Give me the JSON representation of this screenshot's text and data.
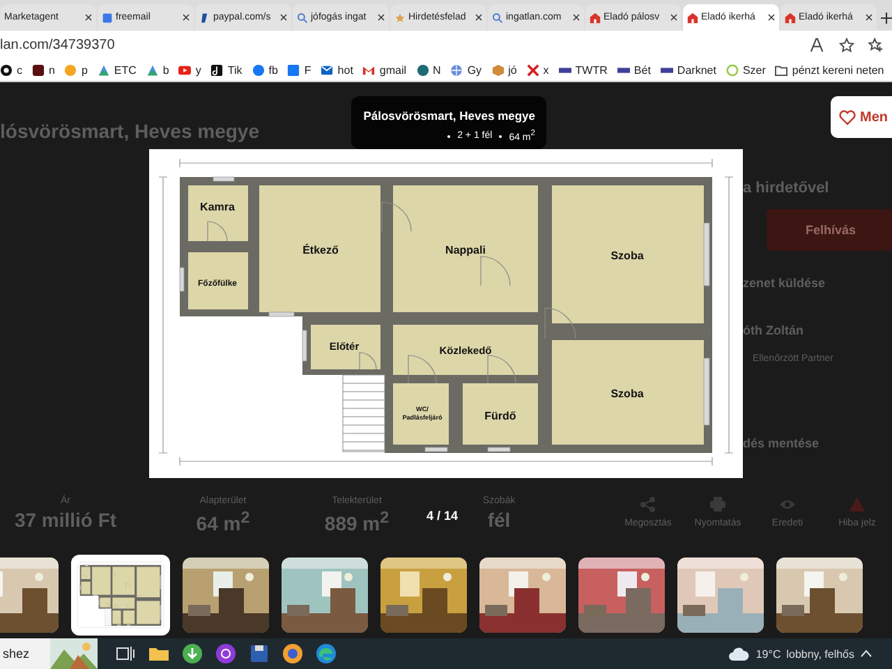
{
  "browser": {
    "tabs": [
      {
        "label": "Marketagent",
        "kind": "plain",
        "selected": false
      },
      {
        "label": "freemail",
        "kind": "square",
        "selected": false
      },
      {
        "label": "paypal.com/s",
        "kind": "slant",
        "selected": false
      },
      {
        "label": "jófogás ingat",
        "kind": "search",
        "selected": false
      },
      {
        "label": "Hirdetésfelad",
        "kind": "star",
        "selected": false
      },
      {
        "label": "ingatlan.com",
        "kind": "search",
        "selected": false
      },
      {
        "label": "Eladó pálosv",
        "kind": "house",
        "selected": false
      },
      {
        "label": "Eladó ikerhá",
        "kind": "house",
        "selected": true
      },
      {
        "label": "Eladó ikerhá",
        "kind": "house",
        "selected": false
      }
    ],
    "address": "lan.com/34739370",
    "bookmarks": [
      {
        "label": "c",
        "kind": "disc"
      },
      {
        "label": "n",
        "kind": "maroon"
      },
      {
        "label": "p",
        "kind": "orange"
      },
      {
        "label": "ETC",
        "kind": "chart"
      },
      {
        "label": "b",
        "kind": "chart"
      },
      {
        "label": "y",
        "kind": "play"
      },
      {
        "label": "Tik",
        "kind": "note"
      },
      {
        "label": "fb",
        "kind": "blue"
      },
      {
        "label": "F",
        "kind": "bluesq"
      },
      {
        "label": "hot",
        "kind": "mail"
      },
      {
        "label": "gmail",
        "kind": "gmail"
      },
      {
        "label": "N",
        "kind": "teal"
      },
      {
        "label": "Gy",
        "kind": "globe"
      },
      {
        "label": "jó",
        "kind": "box"
      },
      {
        "label": "x",
        "kind": "x"
      },
      {
        "label": "TWTR",
        "kind": "bar"
      },
      {
        "label": "Bét",
        "kind": "bar"
      },
      {
        "label": "Darknet",
        "kind": "bar"
      },
      {
        "label": "Szer",
        "kind": "ring"
      },
      {
        "label": "pénzt kereni neten",
        "kind": "folder"
      }
    ]
  },
  "page": {
    "heading": "lósvörösmart, Heves megye",
    "save_button": "Men",
    "contact_title": "a hirdetővel",
    "call_button": "Felhívás",
    "message_link": "zenet küldése",
    "agent_name": "óth Zoltán",
    "agent_badge": "Ellenőrzött Partner",
    "save_listing": "dés mentése",
    "stats": [
      {
        "label": "Ár",
        "value": "37 millió Ft"
      },
      {
        "label": "Alapterület",
        "value": "64 m$^{2}$"
      },
      {
        "label": "Telekterület",
        "value": "889 m$^{2}$"
      },
      {
        "label": "Szobák",
        "value": "fél"
      }
    ],
    "actions": [
      {
        "label": "Megosztás",
        "kind": "share"
      },
      {
        "label": "Nyomtatás",
        "kind": "print"
      },
      {
        "label": "Eredeti",
        "kind": "eye"
      },
      {
        "label": "Hiba jelz",
        "kind": "warning"
      }
    ]
  },
  "lightbox": {
    "title": "Pálosvörösmart, Heves megye",
    "details": [
      "2 + 1 fél",
      "64 m$^{2}$"
    ],
    "counter": "4 / 14",
    "rooms": [
      {
        "lines": [
          "Kamra"
        ]
      },
      {
        "lines": [
          "Főzőfülke"
        ]
      },
      {
        "lines": [
          "Étkező"
        ]
      },
      {
        "lines": [
          "Nappali"
        ]
      },
      {
        "lines": [
          "Szoba"
        ]
      },
      {
        "lines": [
          "Előtér"
        ]
      },
      {
        "lines": [
          "Közlekedő"
        ]
      },
      {
        "lines": [
          "WC/",
          "Padlásfeljáró"
        ]
      },
      {
        "lines": [
          "Fürdő"
        ]
      },
      {
        "lines": [
          "Szoba"
        ]
      }
    ],
    "thumbnails": [
      {
        "kind": "picture",
        "selected": false
      },
      {
        "kind": "plan",
        "selected": true
      },
      {
        "kind": "picture",
        "selected": false
      },
      {
        "kind": "picture",
        "selected": false
      },
      {
        "kind": "picture",
        "selected": false
      },
      {
        "kind": "picture",
        "selected": false
      },
      {
        "kind": "picture",
        "selected": false
      },
      {
        "kind": "picture",
        "selected": false
      },
      {
        "kind": "picture",
        "selected": false
      }
    ]
  },
  "taskbar": {
    "search": "shez",
    "temperature": "19°C",
    "weather": "lobbny, felhős"
  }
}
